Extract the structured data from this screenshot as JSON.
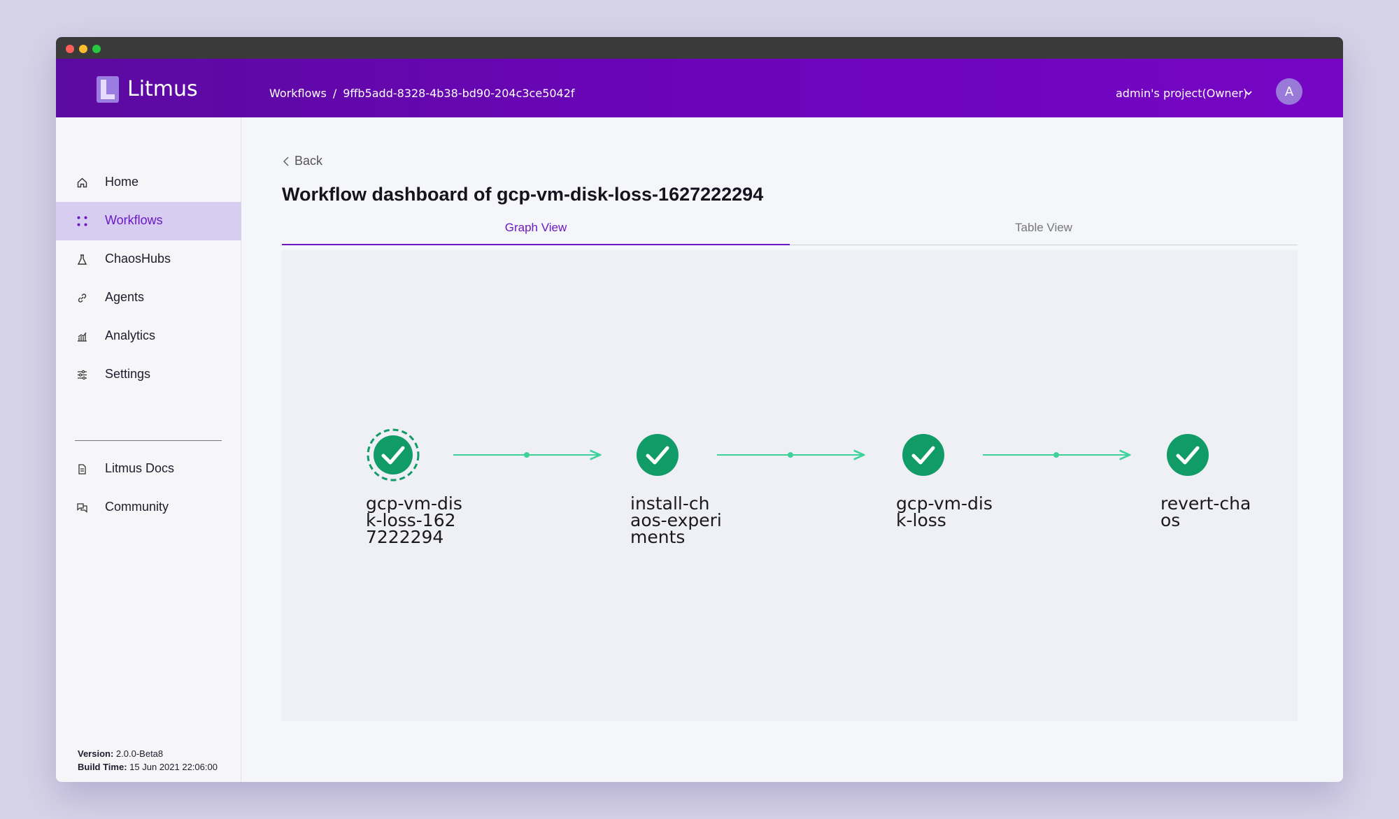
{
  "window": {
    "controls": [
      "close",
      "minimize",
      "maximize"
    ]
  },
  "header": {
    "logo_text": "Litmus",
    "breadcrumb": [
      "Workflows",
      "9ffb5add-8328-4b38-bd90-204c3ce5042f"
    ],
    "breadcrumb_separator": "/",
    "project_label": "admin's project(Owner)",
    "avatar_initial": "A",
    "brand_color": "#6c04b9"
  },
  "sidebar": {
    "items": [
      {
        "label": "Home",
        "icon": "home-icon",
        "active": false
      },
      {
        "label": "Workflows",
        "icon": "workflows-icon",
        "active": true
      },
      {
        "label": "ChaosHubs",
        "icon": "flask-icon",
        "active": false
      },
      {
        "label": "Agents",
        "icon": "link-icon",
        "active": false
      },
      {
        "label": "Analytics",
        "icon": "analytics-icon",
        "active": false
      },
      {
        "label": "Settings",
        "icon": "sliders-icon",
        "active": false
      }
    ],
    "secondary_items": [
      {
        "label": "Litmus Docs",
        "icon": "document-icon"
      },
      {
        "label": "Community",
        "icon": "chat-icon"
      }
    ],
    "version_label": "Version:",
    "version_value": "2.0.0-Beta8",
    "build_label": "Build Time:",
    "build_value": "15 Jun 2021 22:06:00"
  },
  "main": {
    "back_label": "Back",
    "title": "Workflow dashboard of gcp-vm-disk-loss-1627222294",
    "tabs": [
      {
        "label": "Graph View",
        "active": true
      },
      {
        "label": "Table View",
        "active": false
      }
    ],
    "graph": {
      "nodes": [
        {
          "label": "gcp-vm-dis k-loss-162 7222294",
          "lines": [
            "gcp-vm-dis",
            "k-loss-162",
            "7222294"
          ],
          "status": "succeeded",
          "root": true
        },
        {
          "label": "install-ch aos-experi ments",
          "lines": [
            "install-ch",
            "aos-experi",
            "ments"
          ],
          "status": "succeeded",
          "root": false
        },
        {
          "label": "gcp-vm-dis k-loss",
          "lines": [
            "gcp-vm-dis",
            "k-loss"
          ],
          "status": "succeeded",
          "root": false
        },
        {
          "label": "revert-cha os",
          "lines": [
            "revert-cha",
            "os"
          ],
          "status": "succeeded",
          "root": false
        }
      ],
      "success_color": "#109b67",
      "edge_color": "#3ed29b"
    }
  }
}
